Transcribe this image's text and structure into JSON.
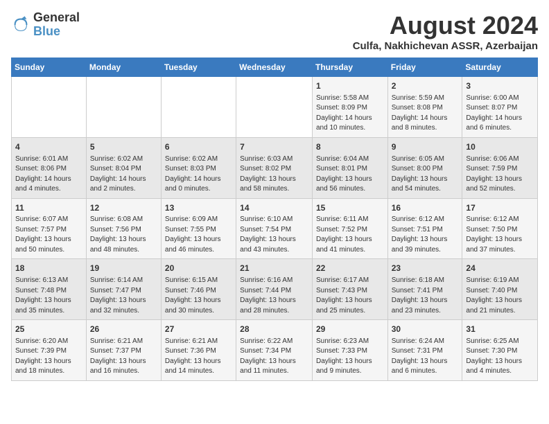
{
  "logo": {
    "text_general": "General",
    "text_blue": "Blue"
  },
  "title": "August 2024",
  "location": "Culfa, Nakhichevan ASSR, Azerbaijan",
  "headers": [
    "Sunday",
    "Monday",
    "Tuesday",
    "Wednesday",
    "Thursday",
    "Friday",
    "Saturday"
  ],
  "weeks": [
    [
      {
        "day": "",
        "content": ""
      },
      {
        "day": "",
        "content": ""
      },
      {
        "day": "",
        "content": ""
      },
      {
        "day": "",
        "content": ""
      },
      {
        "day": "1",
        "content": "Sunrise: 5:58 AM\nSunset: 8:09 PM\nDaylight: 14 hours\nand 10 minutes."
      },
      {
        "day": "2",
        "content": "Sunrise: 5:59 AM\nSunset: 8:08 PM\nDaylight: 14 hours\nand 8 minutes."
      },
      {
        "day": "3",
        "content": "Sunrise: 6:00 AM\nSunset: 8:07 PM\nDaylight: 14 hours\nand 6 minutes."
      }
    ],
    [
      {
        "day": "4",
        "content": "Sunrise: 6:01 AM\nSunset: 8:06 PM\nDaylight: 14 hours\nand 4 minutes."
      },
      {
        "day": "5",
        "content": "Sunrise: 6:02 AM\nSunset: 8:04 PM\nDaylight: 14 hours\nand 2 minutes."
      },
      {
        "day": "6",
        "content": "Sunrise: 6:02 AM\nSunset: 8:03 PM\nDaylight: 14 hours\nand 0 minutes."
      },
      {
        "day": "7",
        "content": "Sunrise: 6:03 AM\nSunset: 8:02 PM\nDaylight: 13 hours\nand 58 minutes."
      },
      {
        "day": "8",
        "content": "Sunrise: 6:04 AM\nSunset: 8:01 PM\nDaylight: 13 hours\nand 56 minutes."
      },
      {
        "day": "9",
        "content": "Sunrise: 6:05 AM\nSunset: 8:00 PM\nDaylight: 13 hours\nand 54 minutes."
      },
      {
        "day": "10",
        "content": "Sunrise: 6:06 AM\nSunset: 7:59 PM\nDaylight: 13 hours\nand 52 minutes."
      }
    ],
    [
      {
        "day": "11",
        "content": "Sunrise: 6:07 AM\nSunset: 7:57 PM\nDaylight: 13 hours\nand 50 minutes."
      },
      {
        "day": "12",
        "content": "Sunrise: 6:08 AM\nSunset: 7:56 PM\nDaylight: 13 hours\nand 48 minutes."
      },
      {
        "day": "13",
        "content": "Sunrise: 6:09 AM\nSunset: 7:55 PM\nDaylight: 13 hours\nand 46 minutes."
      },
      {
        "day": "14",
        "content": "Sunrise: 6:10 AM\nSunset: 7:54 PM\nDaylight: 13 hours\nand 43 minutes."
      },
      {
        "day": "15",
        "content": "Sunrise: 6:11 AM\nSunset: 7:52 PM\nDaylight: 13 hours\nand 41 minutes."
      },
      {
        "day": "16",
        "content": "Sunrise: 6:12 AM\nSunset: 7:51 PM\nDaylight: 13 hours\nand 39 minutes."
      },
      {
        "day": "17",
        "content": "Sunrise: 6:12 AM\nSunset: 7:50 PM\nDaylight: 13 hours\nand 37 minutes."
      }
    ],
    [
      {
        "day": "18",
        "content": "Sunrise: 6:13 AM\nSunset: 7:48 PM\nDaylight: 13 hours\nand 35 minutes."
      },
      {
        "day": "19",
        "content": "Sunrise: 6:14 AM\nSunset: 7:47 PM\nDaylight: 13 hours\nand 32 minutes."
      },
      {
        "day": "20",
        "content": "Sunrise: 6:15 AM\nSunset: 7:46 PM\nDaylight: 13 hours\nand 30 minutes."
      },
      {
        "day": "21",
        "content": "Sunrise: 6:16 AM\nSunset: 7:44 PM\nDaylight: 13 hours\nand 28 minutes."
      },
      {
        "day": "22",
        "content": "Sunrise: 6:17 AM\nSunset: 7:43 PM\nDaylight: 13 hours\nand 25 minutes."
      },
      {
        "day": "23",
        "content": "Sunrise: 6:18 AM\nSunset: 7:41 PM\nDaylight: 13 hours\nand 23 minutes."
      },
      {
        "day": "24",
        "content": "Sunrise: 6:19 AM\nSunset: 7:40 PM\nDaylight: 13 hours\nand 21 minutes."
      }
    ],
    [
      {
        "day": "25",
        "content": "Sunrise: 6:20 AM\nSunset: 7:39 PM\nDaylight: 13 hours\nand 18 minutes."
      },
      {
        "day": "26",
        "content": "Sunrise: 6:21 AM\nSunset: 7:37 PM\nDaylight: 13 hours\nand 16 minutes."
      },
      {
        "day": "27",
        "content": "Sunrise: 6:21 AM\nSunset: 7:36 PM\nDaylight: 13 hours\nand 14 minutes."
      },
      {
        "day": "28",
        "content": "Sunrise: 6:22 AM\nSunset: 7:34 PM\nDaylight: 13 hours\nand 11 minutes."
      },
      {
        "day": "29",
        "content": "Sunrise: 6:23 AM\nSunset: 7:33 PM\nDaylight: 13 hours\nand 9 minutes."
      },
      {
        "day": "30",
        "content": "Sunrise: 6:24 AM\nSunset: 7:31 PM\nDaylight: 13 hours\nand 6 minutes."
      },
      {
        "day": "31",
        "content": "Sunrise: 6:25 AM\nSunset: 7:30 PM\nDaylight: 13 hours\nand 4 minutes."
      }
    ]
  ]
}
